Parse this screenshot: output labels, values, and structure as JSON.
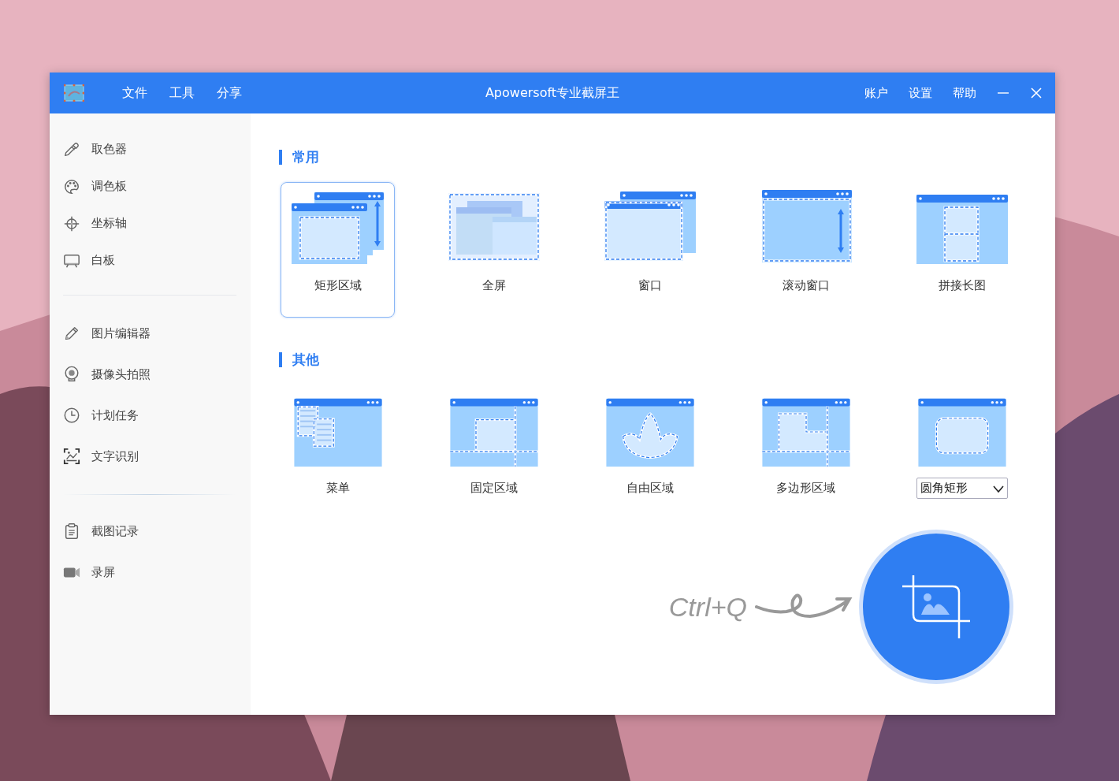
{
  "window": {
    "title": "Apowersoft专业截屏王"
  },
  "menu": [
    "文件",
    "工具",
    "分享"
  ],
  "title_actions": [
    "账户",
    "设置",
    "帮助"
  ],
  "sidebar": {
    "groups": [
      {
        "items": [
          {
            "label": "取色器",
            "kind": "eyedropper"
          },
          {
            "label": "调色板",
            "kind": "palette"
          },
          {
            "label": "坐标轴",
            "kind": "crosshair"
          },
          {
            "label": "白板",
            "kind": "board"
          }
        ]
      },
      {
        "items": [
          {
            "label": "图片编辑器",
            "kind": "pencil"
          },
          {
            "label": "摄像头拍照",
            "kind": "webcam"
          },
          {
            "label": "计划任务",
            "kind": "clock"
          },
          {
            "label": "文字识别",
            "kind": "scan"
          }
        ]
      },
      {
        "items": [
          {
            "label": "截图记录",
            "kind": "clipboard"
          },
          {
            "label": "录屏",
            "kind": "camera"
          }
        ]
      }
    ]
  },
  "sections": [
    {
      "title": "常用",
      "modes": [
        {
          "label": "矩形区域",
          "kind": "region",
          "selected": true
        },
        {
          "label": "全屏",
          "kind": "fullscreen",
          "selected": false
        },
        {
          "label": "窗口",
          "kind": "window",
          "selected": false
        },
        {
          "label": "滚动窗口",
          "kind": "scroll",
          "selected": false
        },
        {
          "label": "拼接长图",
          "kind": "stitch",
          "selected": false
        }
      ]
    },
    {
      "title": "其他",
      "modes": [
        {
          "label": "菜单",
          "kind": "menu",
          "selected": false
        },
        {
          "label": "固定区域",
          "kind": "fixed",
          "selected": false
        },
        {
          "label": "自由区域",
          "kind": "free",
          "selected": false
        },
        {
          "label": "多边形区域",
          "kind": "polygon",
          "selected": false
        },
        {
          "kind": "rounded",
          "selected": false,
          "dropdown": {
            "value": "圆角矩形"
          }
        }
      ]
    }
  ],
  "capture": {
    "shortcut": "Ctrl+Q"
  }
}
